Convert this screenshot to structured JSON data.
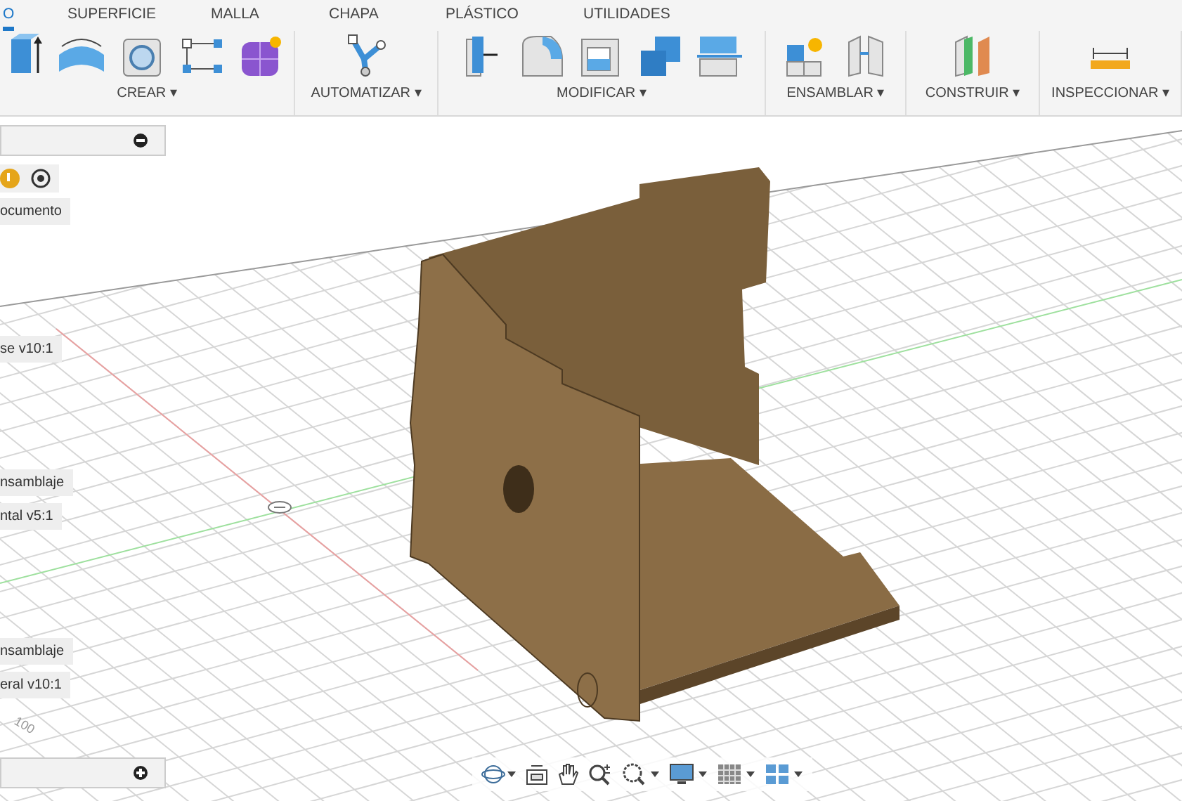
{
  "tabs": [
    {
      "label": "O",
      "selected": true
    },
    {
      "label": "SUPERFICIE",
      "selected": false
    },
    {
      "label": "MALLA",
      "selected": false
    },
    {
      "label": "CHAPA",
      "selected": false
    },
    {
      "label": "PLÁSTICO",
      "selected": false
    },
    {
      "label": "UTILIDADES",
      "selected": false
    }
  ],
  "toolbar_groups": [
    {
      "label": "CREAR ▾"
    },
    {
      "label": "AUTOMATIZAR ▾"
    },
    {
      "label": "MODIFICAR ▾"
    },
    {
      "label": "ENSAMBLAR ▾"
    },
    {
      "label": "CONSTRUIR ▾"
    },
    {
      "label": "INSPECCIONAR ▾"
    }
  ],
  "browser_panel": {
    "items": [
      "ocumento",
      "se v10:1",
      "nsamblaje",
      "ntal v5:1",
      "nsamblaje",
      "eral v10:1"
    ]
  },
  "grid_label": "100"
}
